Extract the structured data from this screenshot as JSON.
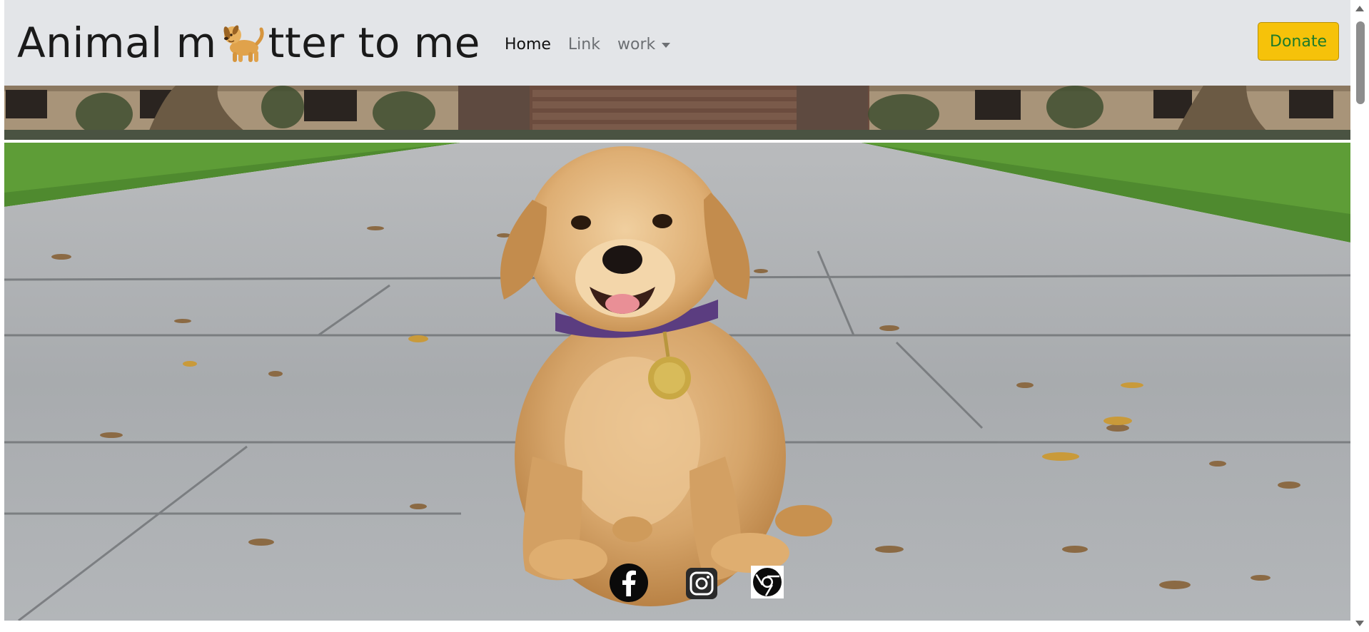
{
  "navbar": {
    "brand_prefix": "Animal m",
    "brand_emoji": "dog-icon",
    "brand_suffix": "tter to me",
    "links": [
      {
        "label": "Home",
        "active": true
      },
      {
        "label": "Link",
        "active": false
      },
      {
        "label": "work",
        "active": false,
        "dropdown": true
      }
    ],
    "donate_label": "Donate"
  },
  "hero": {
    "image": "golden-retriever-puppy-photo"
  },
  "social": [
    {
      "icon": "facebook-icon"
    },
    {
      "icon": "instagram-icon"
    },
    {
      "icon": "chrome-icon"
    }
  ],
  "colors": {
    "navbar_bg": "#e3e5e8",
    "donate_bg": "#f6c20a",
    "donate_text": "#1d7b2a"
  }
}
